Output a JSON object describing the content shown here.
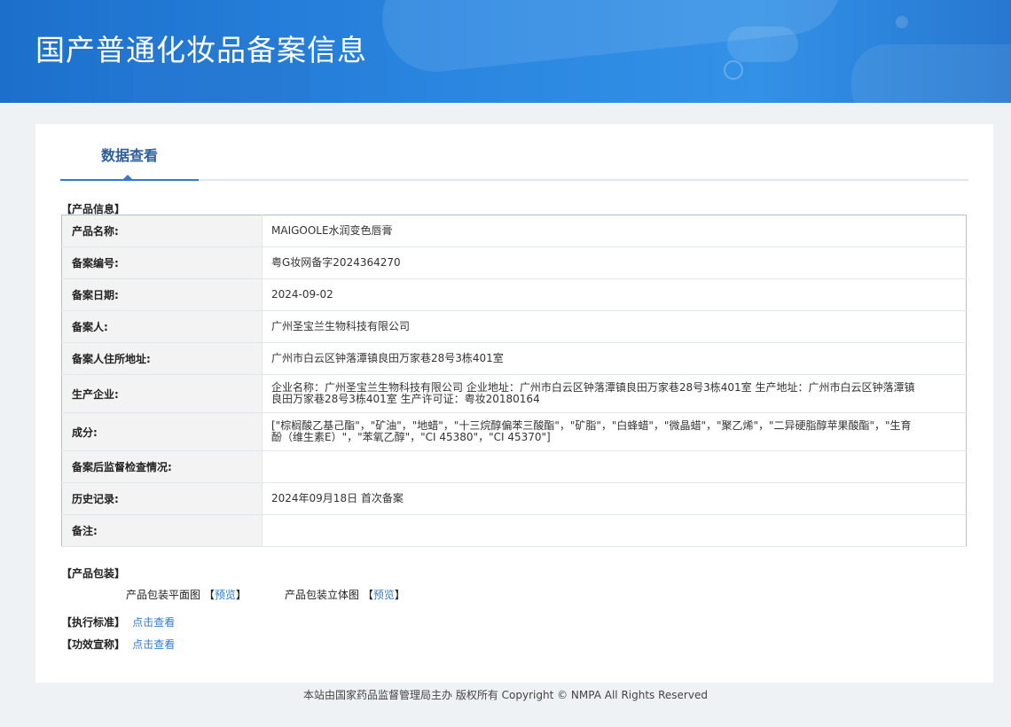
{
  "page": {
    "title": "国产普通化妆品备案信息"
  },
  "tab": {
    "label": "数据查看"
  },
  "product_section": {
    "title": "【产品信息】"
  },
  "rows": [
    {
      "key": "产品名称:",
      "value": "MAIGOOLE水润变色唇膏"
    },
    {
      "key": "备案编号:",
      "value": "粤G妆网备字2024364270"
    },
    {
      "key": "备案日期:",
      "value": "2024-09-02"
    },
    {
      "key": "备案人:",
      "value": "广州圣宝兰生物科技有限公司"
    },
    {
      "key": "备案人住所地址:",
      "value": "广州市白云区钟落潭镇良田万家巷28号3栋401室"
    },
    {
      "key": "生产企业:",
      "value": "企业名称：广州圣宝兰生物科技有限公司 企业地址：广州市白云区钟落潭镇良田万家巷28号3栋401室 生产地址：广州市白云区钟落潭镇良田万家巷28号3栋401室 生产许可证：粤妆20180164"
    },
    {
      "key": "成分:",
      "value": "[\"棕榈酸乙基己酯\"，\"矿油\"，\"地蜡\"，\"十三烷醇偏苯三酸酯\"，\"矿脂\"，\"白蜂蜡\"，\"微晶蜡\"，\"聚乙烯\"，\"二异硬脂醇苹果酸酯\"，\"生育酚（维生素E）\"，\"苯氧乙醇\"，\"CI 45380\"，\"CI 45370\"]"
    },
    {
      "key": "备案后监督检查情况:",
      "value": ""
    },
    {
      "key": "历史记录:",
      "value": "2024年09月18日 首次备案"
    },
    {
      "key": "备注:",
      "value": ""
    }
  ],
  "packaging": {
    "title": "【产品包装】",
    "flat_label": "产品包装平面图",
    "three_d_label": "产品包装立体图",
    "bracket_open": "【",
    "bracket_close": "】",
    "preview_link": "预览"
  },
  "standard": {
    "title": "【执行标准】",
    "link": "点击查看"
  },
  "claims": {
    "title": "【功效宣称】",
    "link": "点击查看"
  },
  "footer": {
    "text": "本站由国家药品监督管理局主办 版权所有 Copyright © NMPA All Rights Reserved"
  }
}
